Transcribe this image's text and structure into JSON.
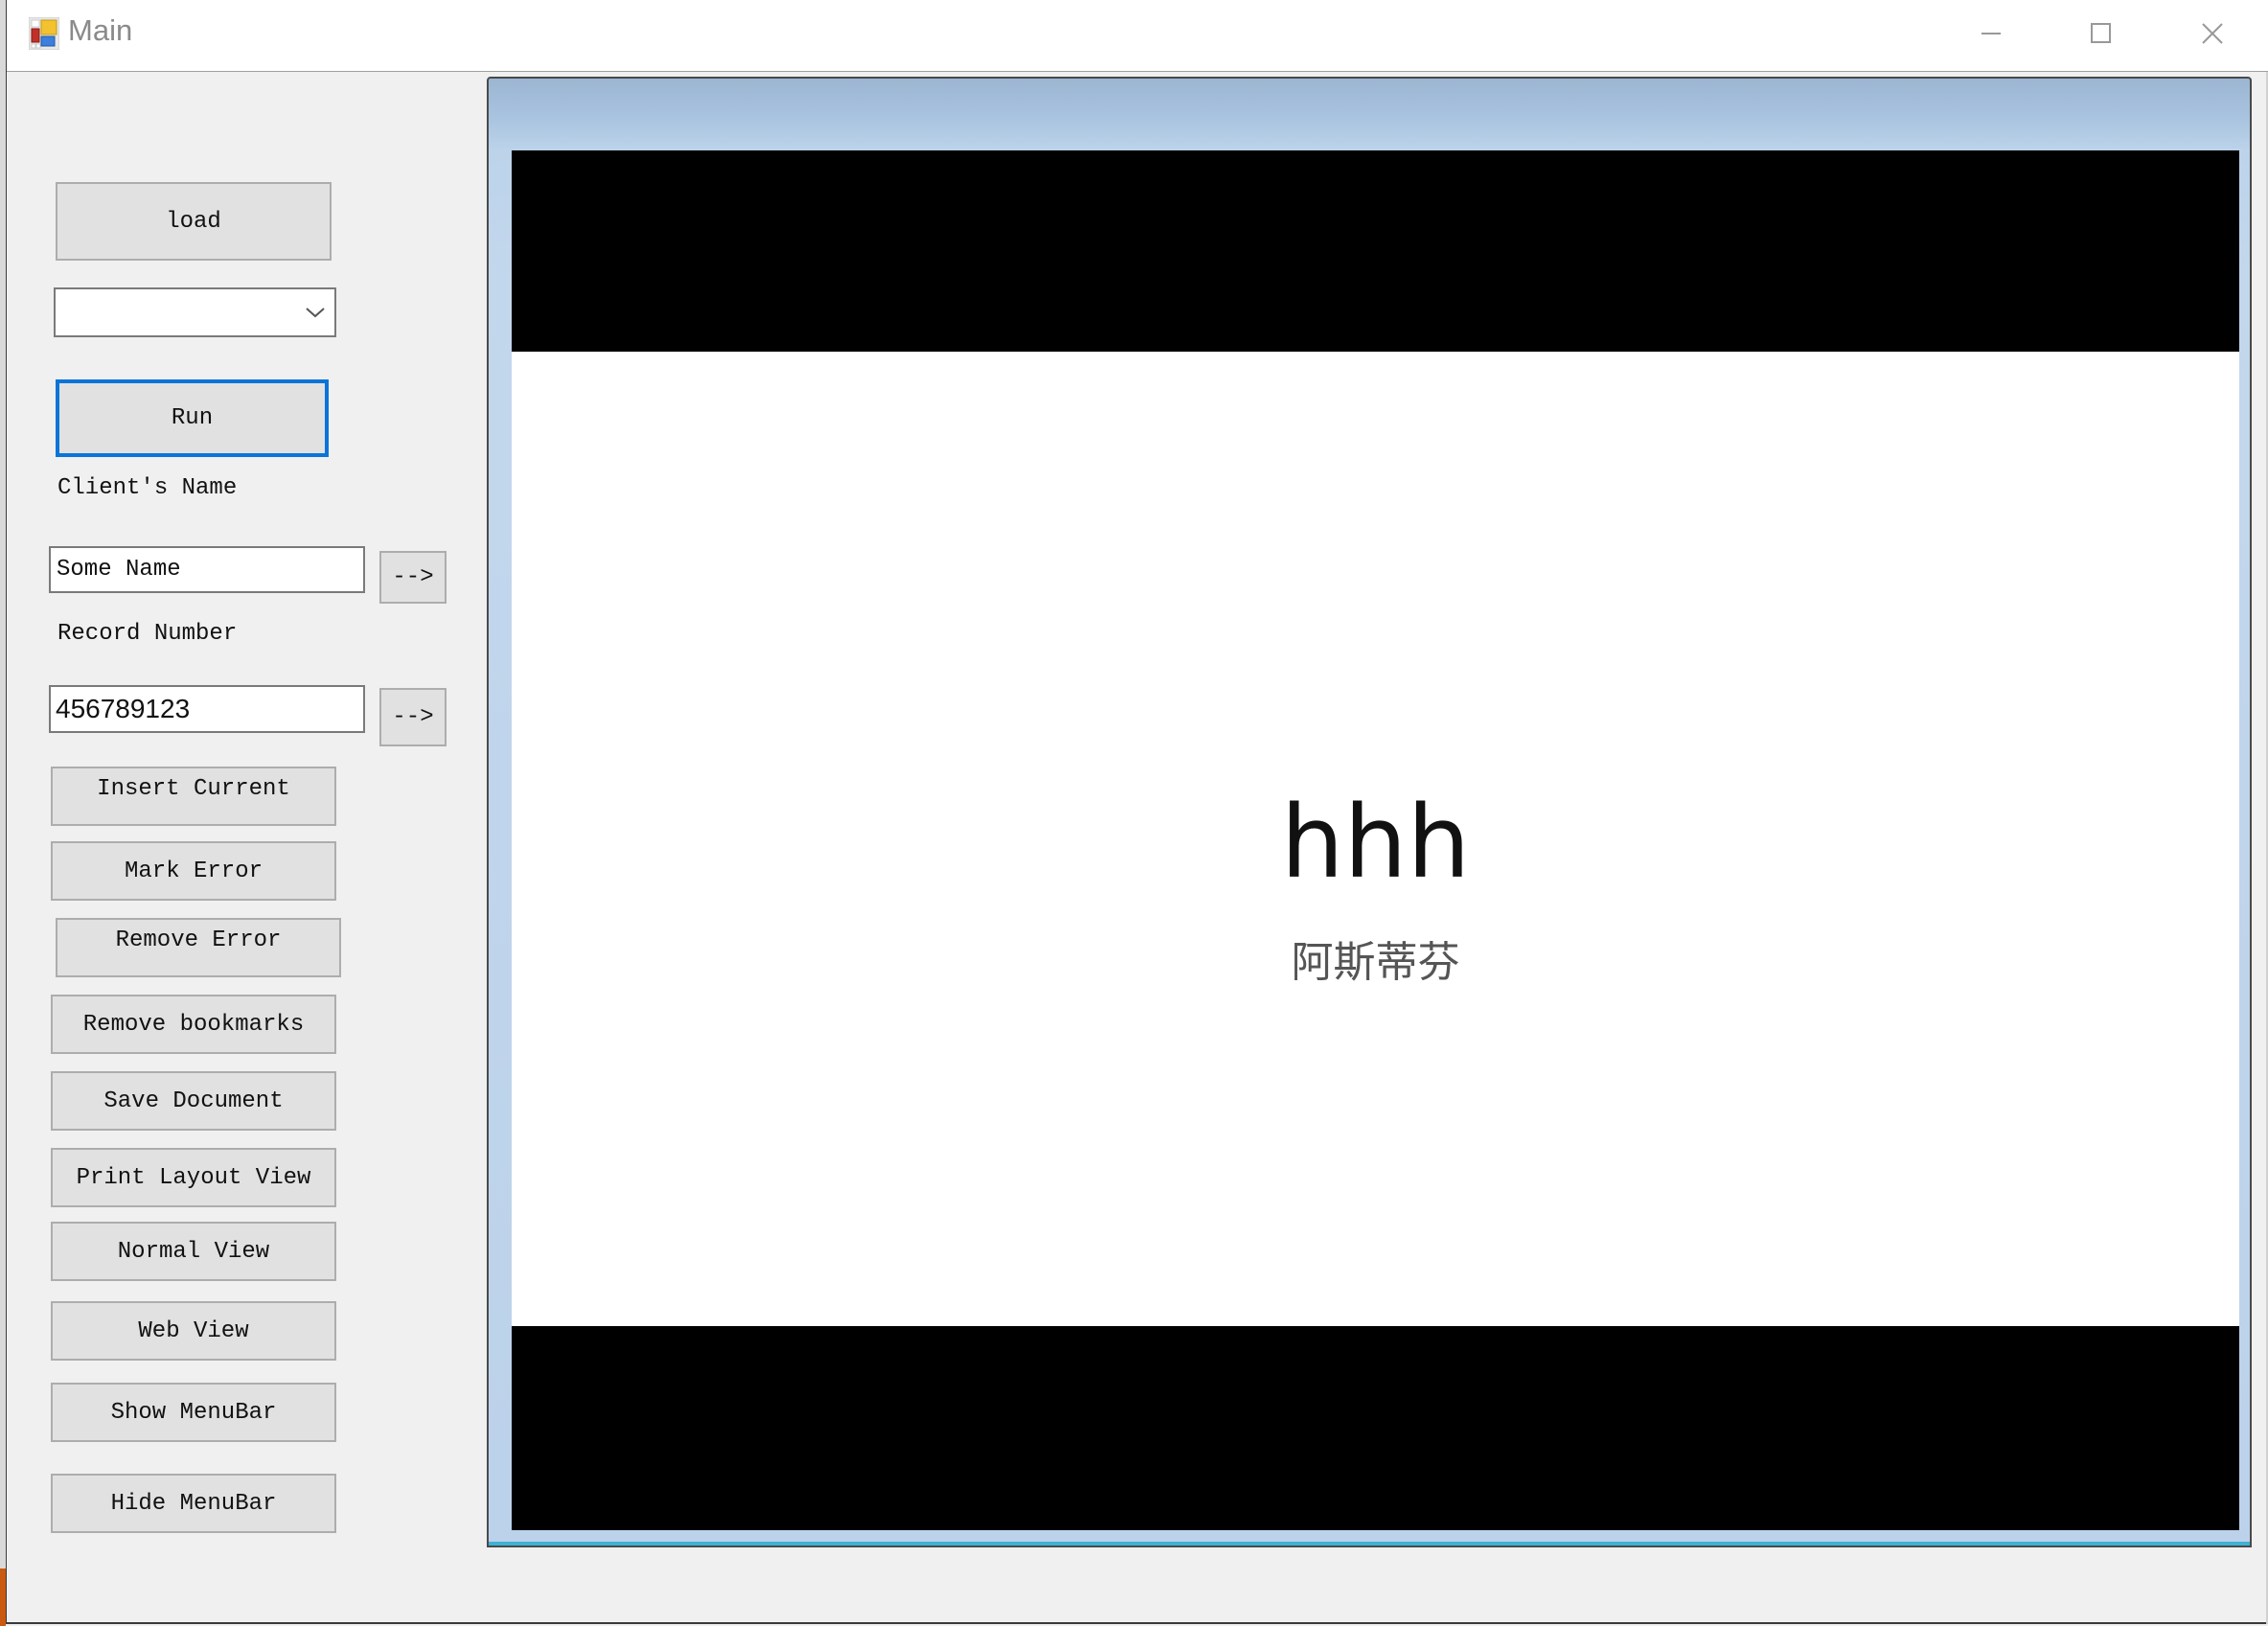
{
  "window": {
    "title": "Main",
    "icon": "app-window-icon",
    "controls": [
      "minimize-icon",
      "maximize-icon",
      "close-icon"
    ]
  },
  "sidebar": {
    "load_label": "load",
    "combo": {
      "selected": ""
    },
    "run_label": "Run",
    "client_name_label": "Client's Name",
    "client_name_value": "Some Name",
    "client_name_go_label": "-->",
    "record_number_label": "Record Number",
    "record_number_value": "456789123",
    "record_number_go_label": "-->",
    "buttons": [
      {
        "label": "Insert Current"
      },
      {
        "label": "Mark Error"
      },
      {
        "label": "Remove Error"
      },
      {
        "label": "Remove bookmarks"
      },
      {
        "label": "Save Document"
      },
      {
        "label": "Print Layout View"
      },
      {
        "label": "Normal View"
      },
      {
        "label": "Web View"
      },
      {
        "label": "Show MenuBar"
      },
      {
        "label": "Hide MenuBar"
      }
    ]
  },
  "document": {
    "heading": "hhh",
    "subheading": "阿斯蒂芬"
  }
}
